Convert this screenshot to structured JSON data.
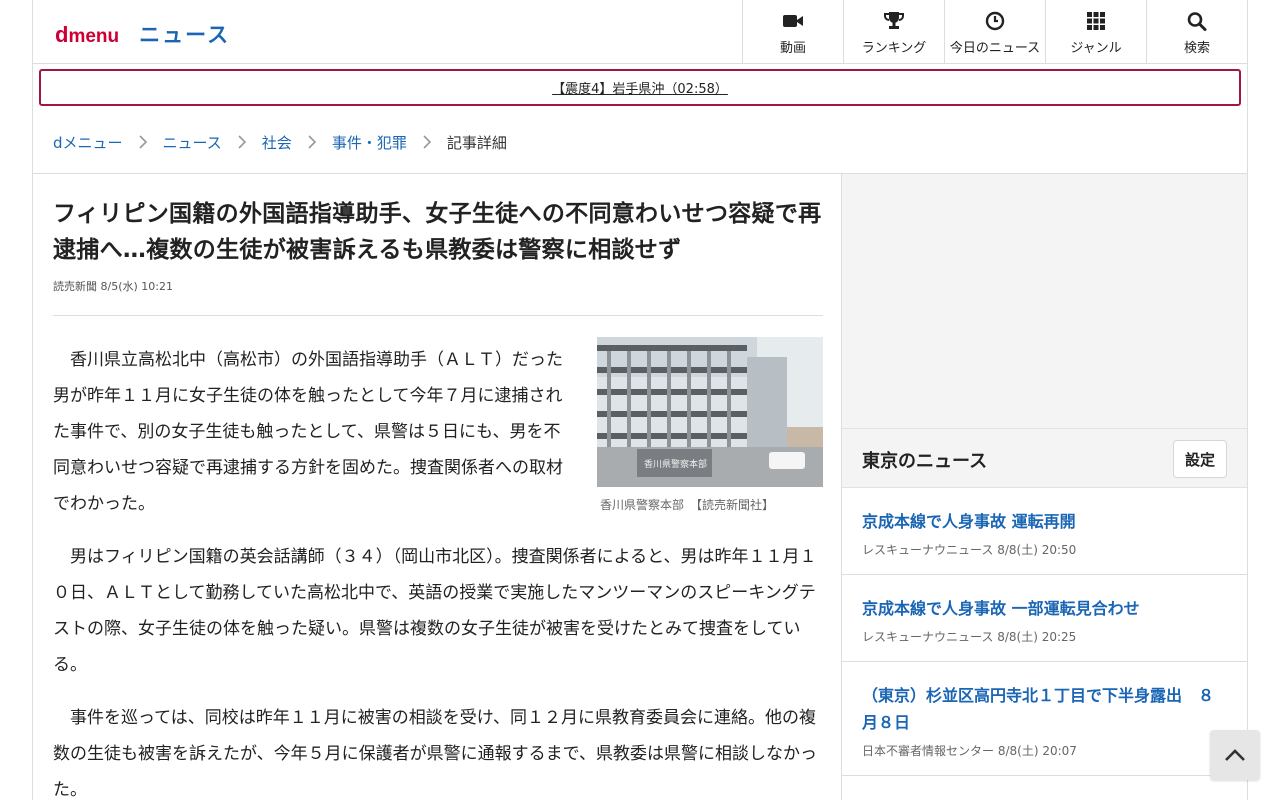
{
  "header": {
    "logo_d": "d",
    "logo_menu": "menu",
    "section": "ニュース",
    "nav": [
      {
        "label": "動画",
        "icon": "video-camera-icon"
      },
      {
        "label": "ランキング",
        "icon": "trophy-icon"
      },
      {
        "label": "今日のニュース",
        "icon": "clock-icon"
      },
      {
        "label": "ジャンル",
        "icon": "grid-icon"
      },
      {
        "label": "検索",
        "icon": "search-icon"
      }
    ]
  },
  "alert": {
    "text": "【震度4】岩手県沖（02:58）",
    "border_color": "#a31545"
  },
  "breadcrumb": {
    "items": [
      "dメニュー",
      "ニュース",
      "社会",
      "事件・犯罪"
    ],
    "current": "記事詳細"
  },
  "article": {
    "title": "フィリピン国籍の外国語指導助手、女子生徒への不同意わいせつ容疑で再逮捕へ…複数の生徒が被害訴えるも県教委は警察に相談せず",
    "source": "読売新聞",
    "date": "8/5(水) 10:21",
    "photo_caption": "香川県警察本部　【読売新聞社】",
    "photo_sign": "香川県警察本部",
    "paragraphs": [
      "香川県立高松北中（高松市）の外国語指導助手（ＡＬＴ）だった男が昨年１１月に女子生徒の体を触ったとして今年７月に逮捕された事件で、別の女子生徒も触ったとして、県警は５日にも、男を不同意わいせつ容疑で再逮捕する方針を固めた。捜査関係者への取材でわかった。",
      "男はフィリピン国籍の英会話講師（３４）（岡山市北区）。捜査関係者によると、男は昨年１１月１０日、ＡＬＴとして勤務していた高松北中で、英語の授業で実施したマンツーマンのスピーキングテストの際、女子生徒の体を触った疑い。県警は複数の女子生徒が被害を受けたとみて捜査をしている。",
      "事件を巡っては、同校は昨年１１月に被害の相談を受け、同１２月に県教育委員会に連絡。他の複数の生徒も被害を訴えたが、今年５月に保護者が県警に通報するまで、県教委は県警に相談しなかった。"
    ]
  },
  "sidebar": {
    "title": "東京のニュース",
    "settings_label": "設定",
    "news": [
      {
        "title": "京成本線で人身事故 運転再開",
        "source": "レスキューナウニュース",
        "date": "8/8(土) 20:50"
      },
      {
        "title": "京成本線で人身事故 一部運転見合わせ",
        "source": "レスキューナウニュース",
        "date": "8/8(土) 20:25"
      },
      {
        "title": "（東京）杉並区高円寺北１丁目で下半身露出　８月８日",
        "source": "日本不審者情報センター",
        "date": "8/8(土) 20:07"
      }
    ]
  },
  "colors": {
    "brand": "#cc0033",
    "link": "#1a66b5"
  }
}
